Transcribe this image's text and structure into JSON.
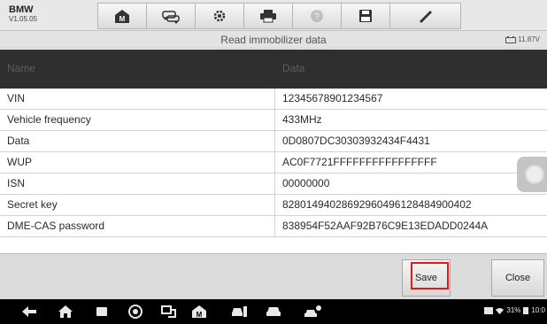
{
  "app": {
    "name": "BMW",
    "version": "V1.05.05"
  },
  "toolbar": {
    "buttons": [
      {
        "icon": "home-icon"
      },
      {
        "icon": "car-swap-icon"
      },
      {
        "icon": "gear-icon"
      },
      {
        "icon": "printer-icon"
      },
      {
        "icon": "help-icon",
        "disabled": true
      },
      {
        "icon": "save-disk-icon"
      },
      {
        "icon": "pen-icon"
      }
    ]
  },
  "screen": {
    "title": "Read immobilizer data",
    "voltage": "11.87V"
  },
  "table": {
    "headers": [
      "Name",
      "Data"
    ],
    "rows": [
      {
        "name": "VIN",
        "data": "12345678901234567"
      },
      {
        "name": "Vehicle frequency",
        "data": "433MHz"
      },
      {
        "name": "Data",
        "data": "0D0807DC30303932434F4431"
      },
      {
        "name": "WUP",
        "data": "AC0F7721FFFFFFFFFFFFFFFF"
      },
      {
        "name": "ISN",
        "data": "00000000"
      },
      {
        "name": "Secret key",
        "data": "82801494028692960496128484900402"
      },
      {
        "name": "DME-CAS password",
        "data": "838954F52AAF92B76C9E13EDADD0244A"
      }
    ]
  },
  "footer": {
    "save_label": "Save",
    "close_label": "Close"
  },
  "statusbar": {
    "battery": "31%",
    "time": "10:0"
  },
  "colors": {
    "highlight": "#e01919",
    "header_bg": "#2f2f2f"
  }
}
